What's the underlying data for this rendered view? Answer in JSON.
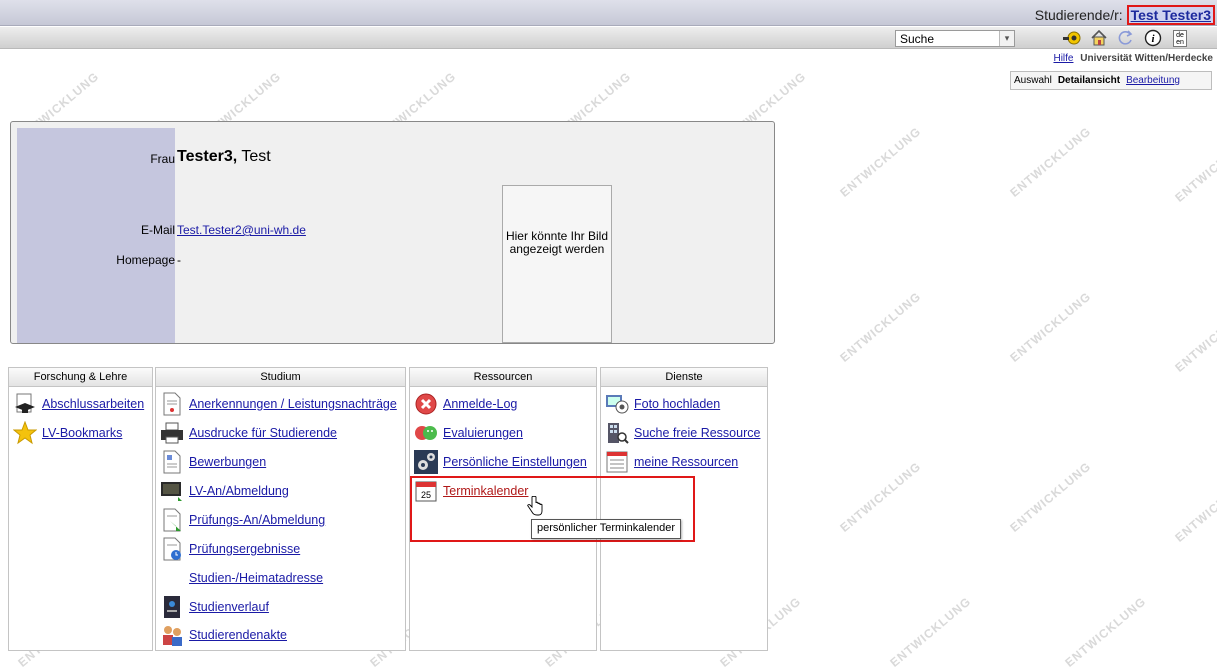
{
  "header": {
    "role_label": "Studierende/r:",
    "username": "Test Tester3"
  },
  "toolbar": {
    "search_select": "Suche",
    "icons": [
      "key-icon",
      "home-icon",
      "refresh-icon",
      "info-icon",
      "language-icon"
    ],
    "language_icon_text": "de en"
  },
  "topnav": {
    "help": "Hilfe",
    "org": "Universität Witten/Herdecke"
  },
  "view_tabs": {
    "auswahl": "Auswahl",
    "detail": "Detailansicht",
    "edit": "Bearbeitung"
  },
  "person": {
    "salutation": "Frau",
    "lastname": "Tester3,",
    "firstname": "Test",
    "email_label": "E-Mail",
    "email": "Test.Tester2@uni-wh.de",
    "homepage_label": "Homepage",
    "homepage": "-",
    "photo_placeholder": "Hier könnte Ihr Bild angezeigt werden"
  },
  "sections": {
    "forschung": {
      "title": "Forschung & Lehre",
      "items": [
        "Abschlussarbeiten",
        "LV-Bookmarks"
      ]
    },
    "studium": {
      "title": "Studium",
      "items": [
        "Anerkennungen / Leistungsnachträge",
        "Ausdrucke für Studierende",
        "Bewerbungen",
        "LV-An/Abmeldung",
        "Prüfungs-An/Abmeldung",
        "Prüfungsergebnisse",
        "Studien-/Heimatadresse",
        "Studienverlauf",
        "Studierendenakte"
      ]
    },
    "ressourcen": {
      "title": "Ressourcen",
      "items": [
        "Anmelde-Log",
        "Evaluierungen",
        "Persönliche Einstellungen",
        "Terminkalender"
      ]
    },
    "dienste": {
      "title": "Dienste",
      "items": [
        "Foto hochladen",
        "Suche freie Ressource",
        "meine Ressourcen"
      ]
    }
  },
  "tooltip": "persönlicher Terminkalender",
  "calendar_day": "25",
  "watermark": "ENTWICKLUNG",
  "colors": {
    "highlight": "#e01818",
    "link": "#1a1aa6",
    "strip": "#c5c6de"
  }
}
